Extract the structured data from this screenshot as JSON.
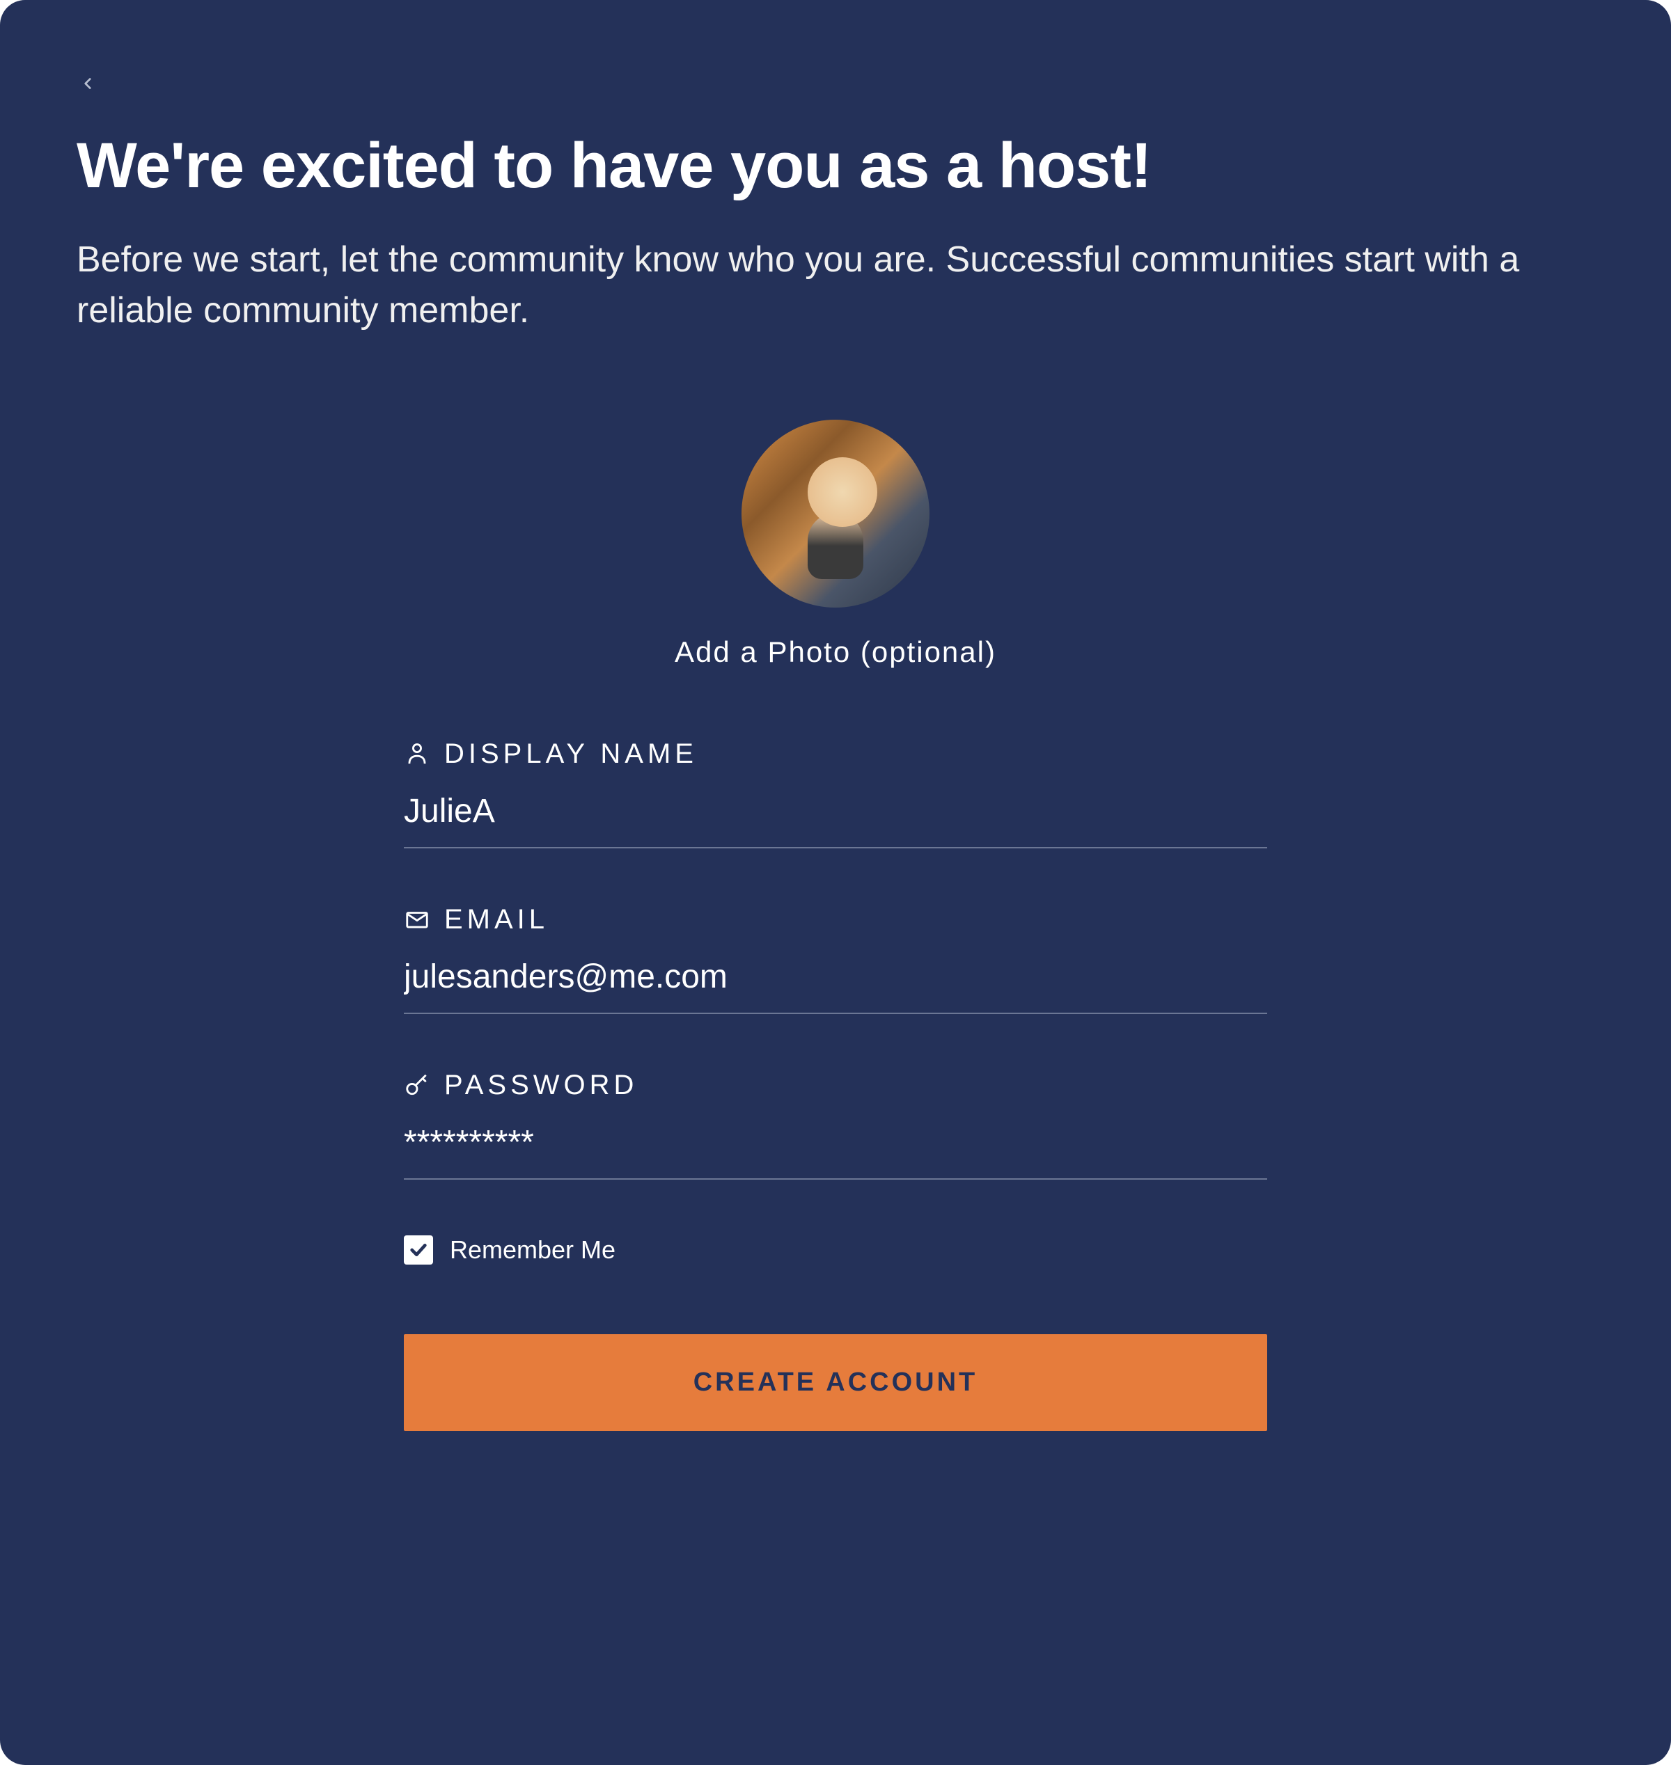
{
  "header": {
    "title": "We're excited to have you as a host!",
    "subtitle": "Before we start, let the community know who you are. Successful communities start with a reliable community member."
  },
  "photo": {
    "label": "Add a Photo (optional)"
  },
  "fields": {
    "display_name": {
      "label": "DISPLAY NAME",
      "value": "JulieA"
    },
    "email": {
      "label": "EMAIL",
      "value": "julesanders@me.com"
    },
    "password": {
      "label": "PASSWORD",
      "value": "**********"
    }
  },
  "remember_me": {
    "label": "Remember Me",
    "checked": true
  },
  "submit": {
    "label": "CREATE ACCOUNT"
  }
}
